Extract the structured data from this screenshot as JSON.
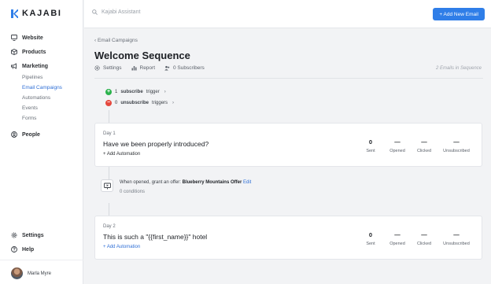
{
  "brand": {
    "name": "KAJABI",
    "accent": "#2f7ee8"
  },
  "sidebar": {
    "items": [
      {
        "label": "Website",
        "icon": "monitor-icon"
      },
      {
        "label": "Products",
        "icon": "box-icon"
      },
      {
        "label": "Marketing",
        "icon": "megaphone-icon"
      },
      {
        "label": "People",
        "icon": "person-circle-icon"
      },
      {
        "label": "Settings",
        "icon": "gear-icon"
      },
      {
        "label": "Help",
        "icon": "question-icon"
      }
    ],
    "marketing_sub": [
      "Pipelines",
      "Email Campaigns",
      "Automations",
      "Events",
      "Forms"
    ],
    "user": {
      "name": "Marla Myre"
    }
  },
  "topbar": {
    "search_placeholder": "Kajabi Assistant",
    "add_button": "+ Add New Email"
  },
  "page": {
    "breadcrumb": "‹ Email Campaigns",
    "title": "Welcome Sequence",
    "meta": {
      "settings": "Settings",
      "report": "Report",
      "subscribers": "0 Subscribers"
    },
    "emails_count": "2 Emails in Sequence"
  },
  "triggers": {
    "subscribe": {
      "count": "1",
      "bold": "subscribe",
      "rest": "trigger"
    },
    "unsubscribe": {
      "count": "0",
      "bold": "unsubscribe",
      "rest": "triggers"
    }
  },
  "emails": [
    {
      "day": "Day 1",
      "subject": "Have we been properly introduced?",
      "automation": "+ Add Automation",
      "stats": [
        {
          "value": "0",
          "label": "Sent"
        },
        {
          "value": "—",
          "label": "Opened"
        },
        {
          "value": "—",
          "label": "Clicked"
        },
        {
          "value": "—",
          "label": "Unsubscribed"
        }
      ]
    },
    {
      "day": "Day 2",
      "subject": "This is such a \"{{first_name}}\" hotel",
      "automation": "+ Add Automation",
      "stats": [
        {
          "value": "0",
          "label": "Sent"
        },
        {
          "value": "—",
          "label": "Opened"
        },
        {
          "value": "—",
          "label": "Clicked"
        },
        {
          "value": "—",
          "label": "Unsubscribed"
        }
      ]
    }
  ],
  "automation": {
    "prefix": "When opened, grant an offer:",
    "offer": "Blueberry Mountains Offer",
    "edit": "Edit",
    "conditions": "0 conditions"
  }
}
